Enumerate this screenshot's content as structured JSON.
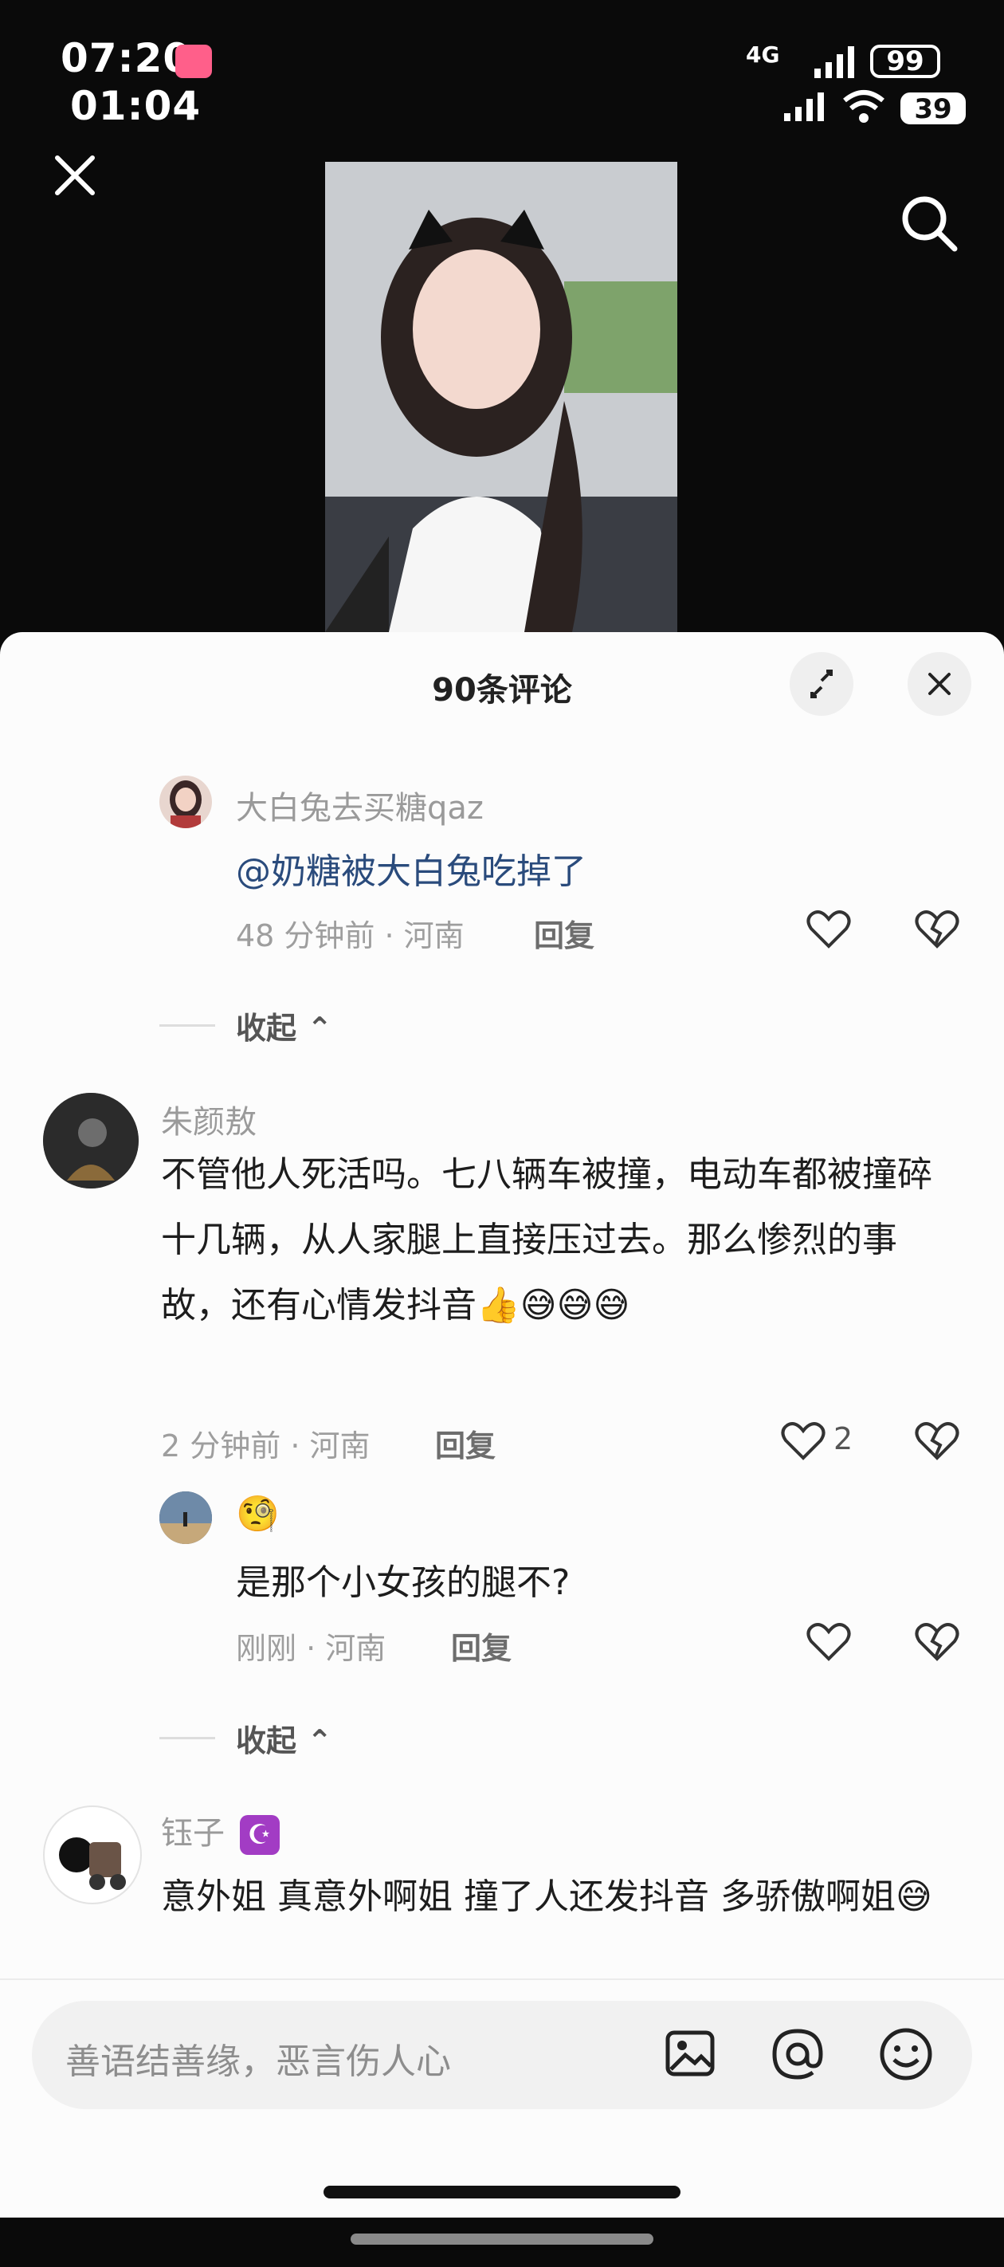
{
  "status": {
    "time_top": "07:20",
    "time_sub": "01:04",
    "battery_main": "99",
    "battery_sub": "39",
    "network": "4G"
  },
  "sheet": {
    "title": "90条评论",
    "input_placeholder": "善语结善缘，恶言伤人心"
  },
  "comments": {
    "reply1": {
      "user": "大白兔去买糖qaz",
      "text": "@奶糖被大白兔吃掉了",
      "meta": "48 分钟前 · 河南",
      "reply_label": "回复"
    },
    "collapse1": "收起",
    "c1": {
      "user": "朱颜敖",
      "text": "不管他人死活吗。七八辆车被撞，电动车都被撞碎十几辆，从人家腿上直接压过去。那么惨烈的事故，还有心情发抖音👍😅😅😅",
      "meta": "2 分钟前 · 河南",
      "reply_label": "回复",
      "likes": "2"
    },
    "c1_reply": {
      "user": "🧐",
      "text": "是那个小女孩的腿不?",
      "meta": "刚刚 · 河南",
      "reply_label": "回复"
    },
    "collapse2": "收起",
    "c2": {
      "user": "钰子",
      "user_badge": "☪",
      "text": "意外姐 真意外啊姐 撞了人还发抖音 多骄傲啊姐😅"
    }
  },
  "icons": {
    "close": "close-icon",
    "search": "search-icon",
    "expand": "expand-icon",
    "heart": "heart-icon",
    "dislike": "broken-heart-icon",
    "image": "image-icon",
    "at": "at-icon",
    "emoji": "emoji-icon"
  }
}
